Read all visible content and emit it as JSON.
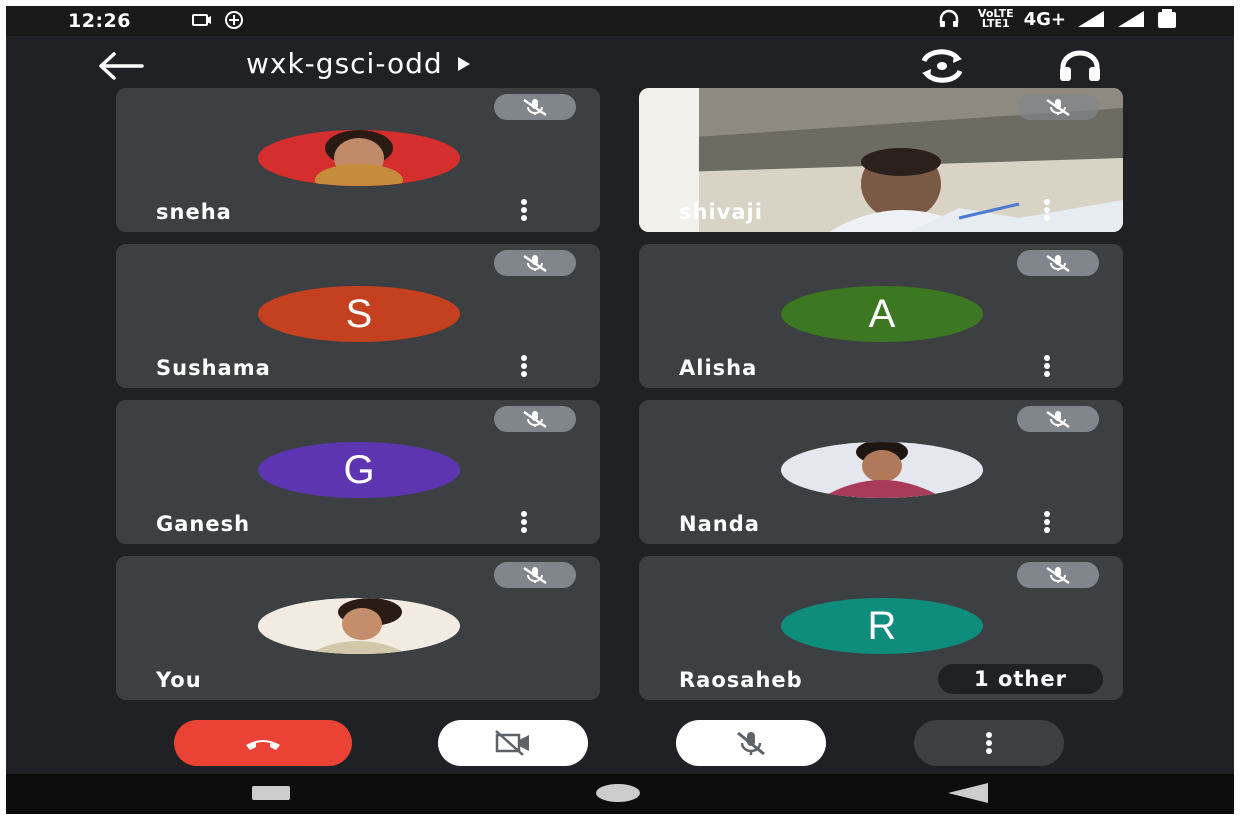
{
  "status_bar": {
    "time": "12:26",
    "network": "4G+",
    "volte": "VoLTE",
    "lte": "LTE1",
    "icons": [
      "cast-icon",
      "hotspot-icon",
      "headset-icon",
      "signal-icon",
      "signal-icon",
      "battery-icon"
    ]
  },
  "header": {
    "meeting_code": "wxk-gsci-odd",
    "back_icon": "arrow-left-icon",
    "expand_icon": "triangle-right-icon",
    "switch_camera_icon": "switch-camera-icon",
    "audio_icon": "headphones-icon"
  },
  "participants": [
    {
      "name": "sneha",
      "avatar_type": "photo",
      "muted": true
    },
    {
      "name": "shivaji",
      "avatar_type": "video",
      "muted": true
    },
    {
      "name": "Sushama",
      "avatar_type": "initial",
      "initial": "S",
      "color": "#c5401f",
      "muted": true
    },
    {
      "name": "Alisha",
      "avatar_type": "initial",
      "initial": "A",
      "color": "#3c7722",
      "muted": true
    },
    {
      "name": "Ganesh",
      "avatar_type": "initial",
      "initial": "G",
      "color": "#5e35b1",
      "muted": true
    },
    {
      "name": "Nanda",
      "avatar_type": "photo",
      "muted": true
    },
    {
      "name": "You",
      "avatar_type": "photo",
      "muted": true
    },
    {
      "name": "Raosaheb",
      "avatar_type": "initial",
      "initial": "R",
      "color": "#0e8c7c",
      "muted": true,
      "others_label": "1 other"
    }
  ],
  "controls": {
    "end_call_icon": "phone-hangup-icon",
    "camera_icon": "camera-off-icon",
    "mic_icon": "mic-off-icon",
    "more_icon": "more-vert-icon",
    "end_call_color": "#ea4335",
    "toggle_color": "#ffffff",
    "more_color": "#3c4043"
  },
  "navbar": {
    "icons": [
      "recents-icon",
      "home-icon",
      "back-icon"
    ]
  }
}
